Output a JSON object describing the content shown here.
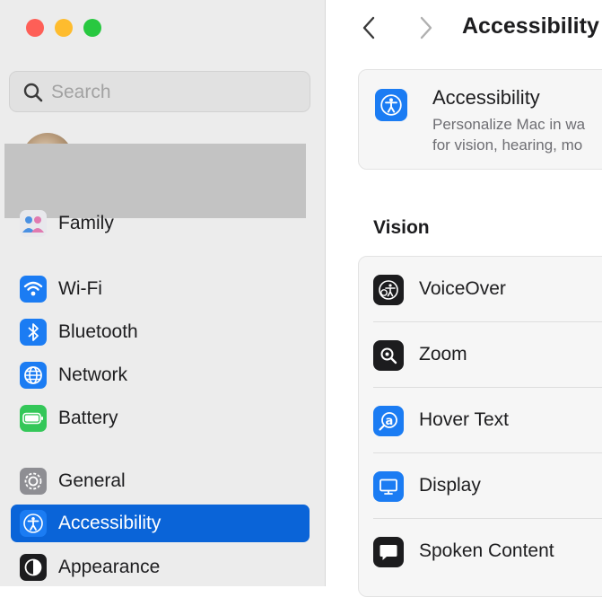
{
  "window": {
    "traffic_lights": [
      "close",
      "minimize",
      "zoom"
    ],
    "colors": {
      "close": "#fe5f57",
      "minimize": "#febc2e",
      "zoom": "#28c840",
      "selection": "#0a64d8"
    }
  },
  "search": {
    "placeholder": "Search",
    "icon": "magnifying-glass"
  },
  "sidebar": {
    "items": [
      {
        "label": "Family",
        "icon": "family-icon"
      },
      {
        "label": "Wi-Fi",
        "icon": "wifi-icon"
      },
      {
        "label": "Bluetooth",
        "icon": "bluetooth-icon"
      },
      {
        "label": "Network",
        "icon": "globe-icon"
      },
      {
        "label": "Battery",
        "icon": "battery-icon"
      },
      {
        "label": "General",
        "icon": "gear-icon"
      },
      {
        "label": "Accessibility",
        "icon": "accessibility-icon",
        "selected": true
      },
      {
        "label": "Appearance",
        "icon": "appearance-icon"
      }
    ]
  },
  "main": {
    "title": "Accessibility",
    "header_card": {
      "title": "Accessibility",
      "description_line1": "Personalize Mac in wa",
      "description_line2": "for vision, hearing, mo"
    },
    "section_label": "Vision",
    "rows": [
      {
        "label": "VoiceOver",
        "icon": "voiceover-icon"
      },
      {
        "label": "Zoom",
        "icon": "zoom-icon"
      },
      {
        "label": "Hover Text",
        "icon": "hover-text-icon"
      },
      {
        "label": "Display",
        "icon": "display-icon"
      },
      {
        "label": "Spoken Content",
        "icon": "spoken-content-icon"
      }
    ]
  }
}
